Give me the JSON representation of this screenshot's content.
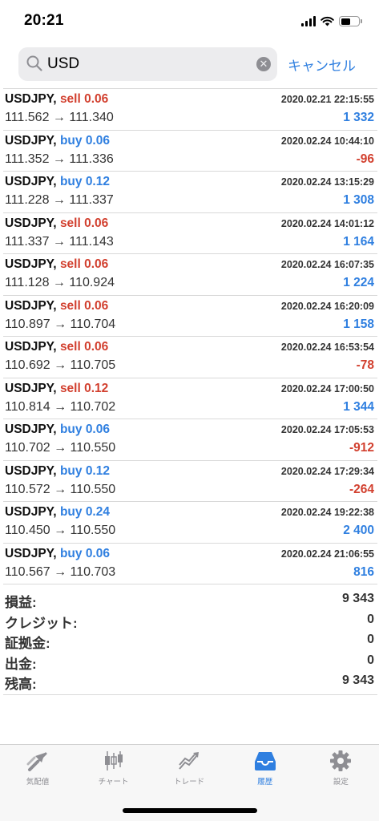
{
  "status": {
    "time": "20:21"
  },
  "search": {
    "value": "USD",
    "cancel_label": "キャンセル"
  },
  "trades": [
    {
      "symbol": "USDJPY,",
      "side": "sell",
      "lots": "0.06",
      "time": "2020.02.21 22:15:55",
      "prices": "111.562 → 111.340",
      "profit": "1 332",
      "profit_sign": "pos"
    },
    {
      "symbol": "USDJPY,",
      "side": "buy",
      "lots": "0.06",
      "time": "2020.02.24 10:44:10",
      "prices": "111.352 → 111.336",
      "profit": "-96",
      "profit_sign": "neg"
    },
    {
      "symbol": "USDJPY,",
      "side": "buy",
      "lots": "0.12",
      "time": "2020.02.24 13:15:29",
      "prices": "111.228 → 111.337",
      "profit": "1 308",
      "profit_sign": "pos"
    },
    {
      "symbol": "USDJPY,",
      "side": "sell",
      "lots": "0.06",
      "time": "2020.02.24 14:01:12",
      "prices": "111.337 → 111.143",
      "profit": "1 164",
      "profit_sign": "pos"
    },
    {
      "symbol": "USDJPY,",
      "side": "sell",
      "lots": "0.06",
      "time": "2020.02.24 16:07:35",
      "prices": "111.128 → 110.924",
      "profit": "1 224",
      "profit_sign": "pos"
    },
    {
      "symbol": "USDJPY,",
      "side": "sell",
      "lots": "0.06",
      "time": "2020.02.24 16:20:09",
      "prices": "110.897 → 110.704",
      "profit": "1 158",
      "profit_sign": "pos"
    },
    {
      "symbol": "USDJPY,",
      "side": "sell",
      "lots": "0.06",
      "time": "2020.02.24 16:53:54",
      "prices": "110.692 → 110.705",
      "profit": "-78",
      "profit_sign": "neg"
    },
    {
      "symbol": "USDJPY,",
      "side": "sell",
      "lots": "0.12",
      "time": "2020.02.24 17:00:50",
      "prices": "110.814 → 110.702",
      "profit": "1 344",
      "profit_sign": "pos"
    },
    {
      "symbol": "USDJPY,",
      "side": "buy",
      "lots": "0.06",
      "time": "2020.02.24 17:05:53",
      "prices": "110.702 → 110.550",
      "profit": "-912",
      "profit_sign": "neg"
    },
    {
      "symbol": "USDJPY,",
      "side": "buy",
      "lots": "0.12",
      "time": "2020.02.24 17:29:34",
      "prices": "110.572 → 110.550",
      "profit": "-264",
      "profit_sign": "neg"
    },
    {
      "symbol": "USDJPY,",
      "side": "buy",
      "lots": "0.24",
      "time": "2020.02.24 19:22:38",
      "prices": "110.450 → 110.550",
      "profit": "2 400",
      "profit_sign": "pos"
    },
    {
      "symbol": "USDJPY,",
      "side": "buy",
      "lots": "0.06",
      "time": "2020.02.24 21:06:55",
      "prices": "110.567 → 110.703",
      "profit": "816",
      "profit_sign": "pos"
    }
  ],
  "summary": [
    {
      "label": "損益:",
      "value": "9 343"
    },
    {
      "label": "クレジット:",
      "value": "0"
    },
    {
      "label": "証拠金:",
      "value": "0"
    },
    {
      "label": "出金:",
      "value": "0"
    },
    {
      "label": "残高:",
      "value": "9 343"
    }
  ],
  "tabs": [
    {
      "label": "気配値",
      "icon": "quotes-icon",
      "active": false
    },
    {
      "label": "チャート",
      "icon": "chart-icon",
      "active": false
    },
    {
      "label": "トレード",
      "icon": "trade-icon",
      "active": false
    },
    {
      "label": "履歴",
      "icon": "history-icon",
      "active": true
    },
    {
      "label": "設定",
      "icon": "settings-icon",
      "active": false
    }
  ],
  "colors": {
    "accent": "#2f7fe0",
    "sell": "#d2402f",
    "buy": "#2f7fe0",
    "inactive_tab": "#8e8e93"
  }
}
